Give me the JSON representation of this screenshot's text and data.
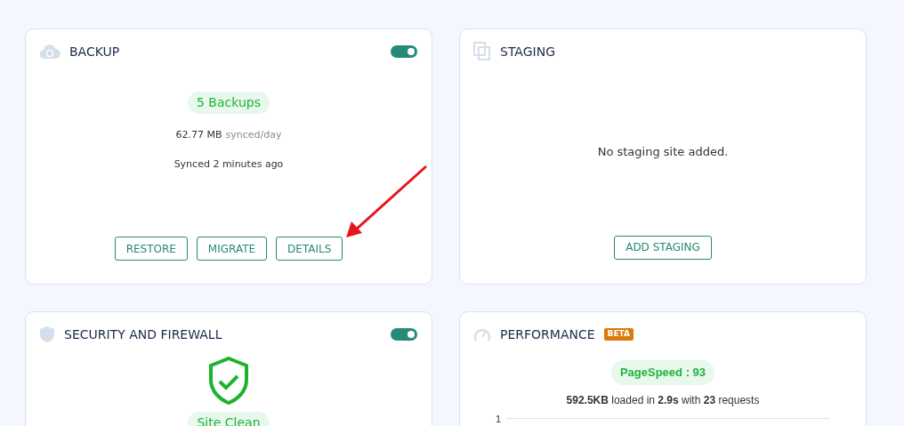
{
  "backup": {
    "title": "BACKUP",
    "on": true,
    "badge": "5 Backups",
    "size": "62.77 MB",
    "size_unit": "synced/day",
    "synced": "Synced 2 minutes ago",
    "buttons": [
      "RESTORE",
      "MIGRATE",
      "DETAILS"
    ]
  },
  "staging": {
    "title": "STAGING",
    "message": "No staging site added.",
    "button": "ADD STAGING"
  },
  "security": {
    "title": "SECURITY AND FIREWALL",
    "on": true,
    "status": "Site Clean"
  },
  "performance": {
    "title": "PERFORMANCE",
    "tag": "BETA",
    "badge": "PageSpeed : 93",
    "summary": "**592.5KB** loaded in **2.9s** with **23** requests",
    "chart_tick": "1"
  }
}
